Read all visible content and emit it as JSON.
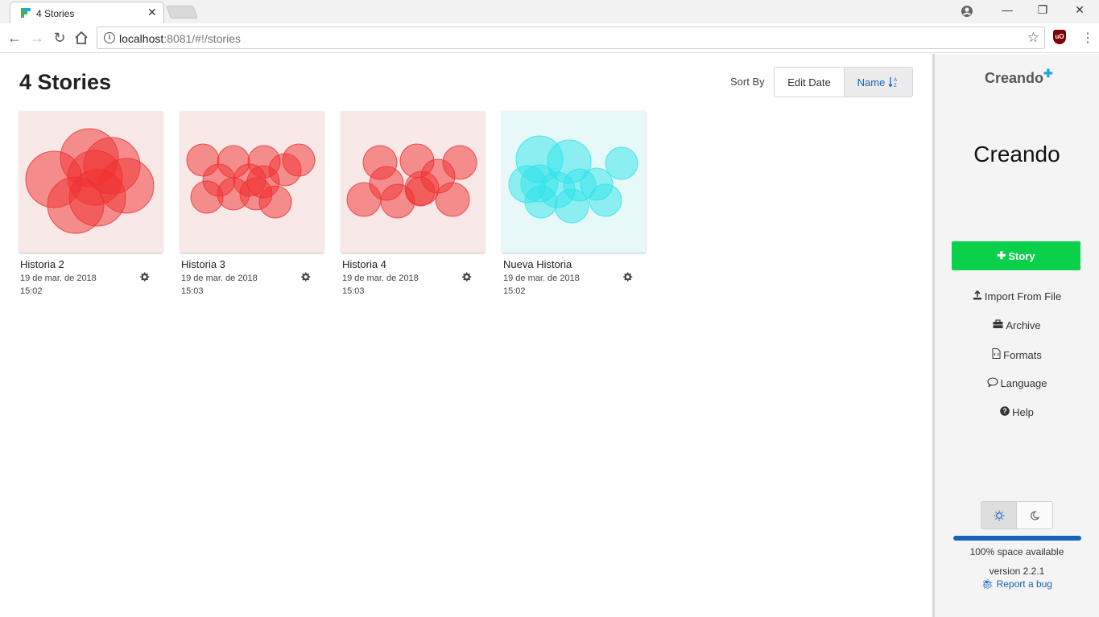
{
  "browser": {
    "tab_title": "4 Stories",
    "tab_close": "✕",
    "url_host": "localhost",
    "url_rest": ":8081/#!/stories",
    "window_controls": [
      "—",
      "❐",
      "✕"
    ]
  },
  "header": {
    "title": "4 Stories",
    "sort_label": "Sort By",
    "sort_options": [
      "Edit Date",
      "Name"
    ],
    "sort_active": "Name"
  },
  "stories": [
    {
      "name": "Historia 2",
      "date": "19 de mar. de 2018",
      "time": "15:02",
      "theme": "red",
      "bg": "#f8e8e8",
      "color": "#f03030"
    },
    {
      "name": "Historia 3",
      "date": "19 de mar. de 2018",
      "time": "15:03",
      "theme": "red",
      "bg": "#f8e8e8",
      "color": "#f03030"
    },
    {
      "name": "Historia 4",
      "date": "19 de mar. de 2018",
      "time": "15:03",
      "theme": "red",
      "bg": "#f8e8e8",
      "color": "#f03030"
    },
    {
      "name": "Nueva Historia",
      "date": "19 de mar. de 2018",
      "time": "15:02",
      "theme": "cyan",
      "bg": "#e6f8f8",
      "color": "#30e4ea"
    }
  ],
  "sidebar": {
    "logo": "Creando",
    "title": "Creando",
    "story_button": "Story",
    "links": [
      {
        "label": "Import From File",
        "icon": "upload-icon"
      },
      {
        "label": "Archive",
        "icon": "briefcase-icon"
      },
      {
        "label": "Formats",
        "icon": "file-code-icon"
      },
      {
        "label": "Language",
        "icon": "speech-bubble-icon"
      },
      {
        "label": "Help",
        "icon": "question-icon"
      }
    ],
    "space_available_percent": 100,
    "space_text": "100% space available",
    "version": "version 2.2.1",
    "bug_link": "Report a bug"
  },
  "colors": {
    "accent": "#1a62b8",
    "story_button": "#0bd04a",
    "red_circle": "#f03030",
    "cyan_circle": "#30e4ea"
  }
}
